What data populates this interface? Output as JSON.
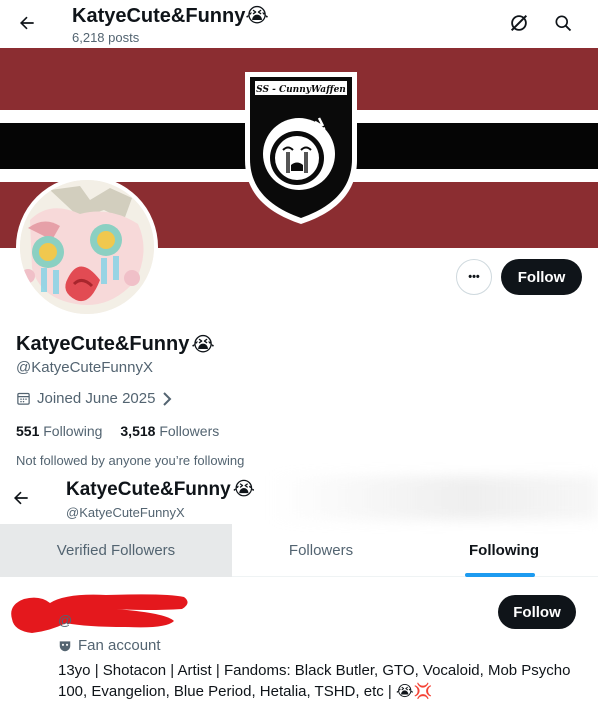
{
  "header": {
    "title": "KatyeCute&Funny",
    "title_emoji": "😭",
    "posts": "6,218 posts"
  },
  "banner": {
    "badge_text": "SS - CunnyWaffen",
    "colors": {
      "red": "#8b2d31",
      "white": "#ffffff",
      "black": "#050505"
    }
  },
  "profile": {
    "more_label": "•••",
    "follow_label": "Follow",
    "name": "KatyeCute&Funny",
    "name_emoji": "😭",
    "handle": "@KatyeCuteFunnyX",
    "joined": "Joined June 2025",
    "following_count": "551",
    "following_label": "Following",
    "followers_count": "3,518",
    "followers_label": "Followers",
    "not_followed": "Not followed by anyone you’re following"
  },
  "list_header": {
    "name": "KatyeCute&Funny",
    "name_emoji": "😭",
    "handle": "@KatyeCuteFunnyX"
  },
  "tabs": [
    {
      "label": "Verified Followers",
      "active": false
    },
    {
      "label": "Followers",
      "active": false
    },
    {
      "label": "Following",
      "active": true
    }
  ],
  "user_row": {
    "handle_prefix": "@",
    "follow_label": "Follow",
    "fan_label": "Fan account",
    "bio": "13yo | Shotacon | Artist | Fandoms: Black Butler, GTO, Vocaloid, Mob Psycho 100, Evangelion, Blue Period, Hetalia, TSHD, etc | 😭💢"
  },
  "accent_color": "#1d9bf0"
}
